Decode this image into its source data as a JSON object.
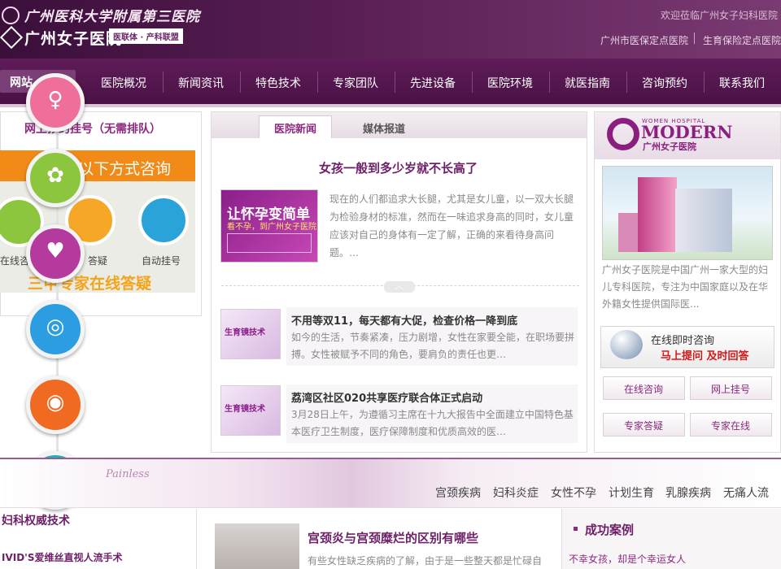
{
  "header": {
    "logo_cn": "广州医科大学附属第三医院",
    "logo_name": "广州女子医院",
    "logo_tag": "医联体 · 产科联盟",
    "welcome": "欢迎莅临广州女子妇科医院",
    "insurance": [
      "广州市医保定点医院",
      "生育保险定点医院"
    ]
  },
  "nav": {
    "items": [
      "网站首页",
      "医院概况",
      "新闻资讯",
      "特色技术",
      "专家团队",
      "先进设备",
      "医院环境",
      "就医指南",
      "咨询预约",
      "联系我们"
    ],
    "home_visible": "网站"
  },
  "left_panel": {
    "register_title": "网上预约挂号（无需排队）",
    "orange_text": "以下方式咨询",
    "consult_items": [
      {
        "label": "在线咨",
        "color": "#8cc63e"
      },
      {
        "label": "答疑",
        "color": "#f7a727"
      },
      {
        "label": "自动挂号",
        "color": "#29a3d8"
      }
    ],
    "expert_answer": "三甲专家在线答疑"
  },
  "float_icons": [
    {
      "name": "pregnancy-icon",
      "color": "#ef6f9a",
      "glyph": "♀"
    },
    {
      "name": "lotus-icon",
      "color": "#8cc63e",
      "glyph": "✿"
    },
    {
      "name": "drop-icon",
      "color": "#b53a9e",
      "glyph": "♥"
    },
    {
      "name": "target-icon",
      "color": "#2b9de0",
      "glyph": "◎"
    },
    {
      "name": "ring-icon",
      "color": "#f06a22",
      "glyph": "◉"
    },
    {
      "name": "plug-icon",
      "color": "#1cb3b0",
      "glyph": "¥"
    }
  ],
  "center": {
    "tabs": [
      "医院新闻",
      "媒体报道"
    ],
    "headline": "女孩一般到多少岁就不长高了",
    "promo_title": "让怀孕变简单",
    "promo_sub": "看不孕，到广州女子医院",
    "headline_summary": "现在的人们都追求大长腿，尤其是女儿童，以一双大长腿为检验身材的标准，然而在一味追求身高的同时，女儿童应该对自己的身体有一定了解，正确的来看待身高问题。…",
    "news": [
      {
        "title": "不用等双11，每天都有大促，检查价格一降到底",
        "summary": "如今的生活，节奏紧凑，压力剧增，女性在家要全能，在职场要拼搏。女性被赋予不同的角色，要肩负的责任也更…",
        "thumb": "生育镜技术"
      },
      {
        "title": "荔湾区社区020共享医疗联合体正式启动",
        "summary": "3月28日上午，为遵循习主席在十九大报告中全面建立中国特色基本医疗卫生制度，医疗保障制度和优质高效的医…",
        "thumb": "生育镜技术"
      }
    ]
  },
  "right_panel": {
    "modern_sub": "WOMEN HOSPITAL",
    "modern_name": "MODERN",
    "modern_cn": "广州女子医院",
    "intro": "广州女子医院是中国广州一家大型的妇儿专科医院，专注为中国家庭以及在华外籍女性提供国际医...",
    "chat_title": "在线即时咨询",
    "chat_action": "马上提问 及时回答",
    "buttons": [
      "在线咨询",
      "网上挂号",
      "专家答疑",
      "专家在线"
    ]
  },
  "banner": {
    "painless": "Painless",
    "tags": [
      "宫颈疾病",
      "妇科炎症",
      "女性不孕",
      "计划生育",
      "乳腺疾病",
      "无痛人流"
    ]
  },
  "bottom": {
    "gyn_title": "妇科权威技术",
    "gyn_item": "IVID'S爱维丝直视人流手术",
    "mid_title": "宫颈炎与宫颈糜烂的区别有哪些",
    "mid_text": "有些女性缺乏疾病的了解，由于是一些整天都是忙碌自",
    "case_title": "成功案例",
    "case_item": "不幸女孩，却是个幸运女人"
  }
}
